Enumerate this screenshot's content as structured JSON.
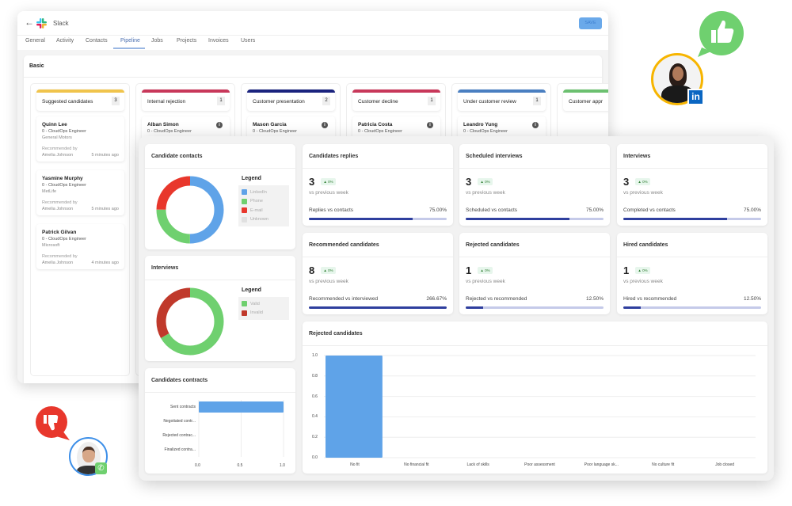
{
  "app": {
    "title": "Slack",
    "save_label": "SAVE"
  },
  "tabs": [
    "General",
    "Activity",
    "Contacts",
    "Pipeline",
    "Jobs",
    "Projects",
    "Invoices",
    "Users"
  ],
  "active_tab": "Pipeline",
  "section_title": "Basic",
  "pipeline": [
    {
      "label": "Suggested candidates",
      "count": "3",
      "color": "#f0c44c",
      "cards": [
        {
          "name": "Quinn Lee",
          "role": "0 - CloudOps Engineer",
          "company": "General Motors",
          "recommended_label": "Recommended by",
          "recommender": "Amelia Johnson",
          "time": "5 minutes ago"
        },
        {
          "name": "Yasmine Murphy",
          "role": "0 - CloudOps Engineer",
          "company": "MetLife",
          "recommended_label": "Recommended by",
          "recommender": "Amelia Johnson",
          "time": "5 minutes ago"
        },
        {
          "name": "Patrick Gilvan",
          "role": "0 - CloudOps Engineer",
          "company": "Microsoft",
          "recommended_label": "Recommended by",
          "recommender": "Amelia Johnson",
          "time": "4 minutes ago"
        }
      ]
    },
    {
      "label": "Internal rejection",
      "count": "1",
      "color": "#c8385a",
      "cards": [
        {
          "name": "Alban Simon",
          "role": "0 - CloudOps Engineer"
        }
      ]
    },
    {
      "label": "Customer presentation",
      "count": "2",
      "color": "#1a237e",
      "cards": [
        {
          "name": "Mason Garcia",
          "role": "0 - CloudOps Engineer"
        }
      ]
    },
    {
      "label": "Customer decline",
      "count": "1",
      "color": "#c8385a",
      "cards": [
        {
          "name": "Patricia Costa",
          "role": "0 - CloudOps Engineer"
        }
      ]
    },
    {
      "label": "Under customer review",
      "count": "1",
      "color": "#4a7fc1",
      "cards": [
        {
          "name": "Leandro Yung",
          "role": "0 - CloudOps Engineer"
        }
      ]
    },
    {
      "label": "Customer appr",
      "count": "",
      "color": "#6cc070",
      "cards": []
    }
  ],
  "stats": [
    {
      "title": "Candidates replies",
      "value": "3",
      "change": "▲ 0%",
      "vs": "vs previous week",
      "progress_label": "Replies vs contacts",
      "progress_value": "75.00%",
      "progress": 75
    },
    {
      "title": "Scheduled interviews",
      "value": "3",
      "change": "▲ 0%",
      "vs": "vs previous week",
      "progress_label": "Scheduled vs contacts",
      "progress_value": "75.00%",
      "progress": 75
    },
    {
      "title": "Interviews",
      "value": "3",
      "change": "▲ 0%",
      "vs": "vs previous week",
      "progress_label": "Completed vs contacts",
      "progress_value": "75.00%",
      "progress": 75
    },
    {
      "title": "Recommended candidates",
      "value": "8",
      "change": "▲ 0%",
      "vs": "vs previous week",
      "progress_label": "Recommended vs interviewed",
      "progress_value": "266.67%",
      "progress": 100
    },
    {
      "title": "Rejected candidates",
      "value": "1",
      "change": "▲ 0%",
      "vs": "vs previous week",
      "progress_label": "Rejected vs recommended",
      "progress_value": "12.50%",
      "progress": 12.5
    },
    {
      "title": "Hired candidates",
      "value": "1",
      "change": "▲ 0%",
      "vs": "vs previous week",
      "progress_label": "Hired vs recommended",
      "progress_value": "12.50%",
      "progress": 12.5
    }
  ],
  "chart_data": [
    {
      "type": "pie",
      "title": "Candidate contacts",
      "legend_title": "Legend",
      "legend": "right",
      "categories": [
        "LinkedIn",
        "Phone",
        "E-mail",
        "Unknown"
      ],
      "values": [
        2,
        1,
        1,
        0
      ],
      "colors": [
        "#5fa3e8",
        "#6fd06f",
        "#e8372c",
        "#e0e0e0"
      ]
    },
    {
      "type": "pie",
      "title": "Interviews",
      "legend_title": "Legend",
      "legend": "right",
      "categories": [
        "Valid",
        "Invalid"
      ],
      "values": [
        2,
        1
      ],
      "colors": [
        "#6fd06f",
        "#c0392b"
      ]
    },
    {
      "type": "bar",
      "orientation": "horizontal",
      "title": "Candidates contracts",
      "categories": [
        "Sent contracts",
        "Negotiated contr...",
        "Rejected contrac...",
        "Finalized contra..."
      ],
      "values": [
        1,
        0,
        0,
        0
      ],
      "xlim": [
        0,
        1
      ],
      "ticks": [
        "0.0",
        "0.5",
        "1.0"
      ],
      "color": "#5fa3e8",
      "grid": true
    },
    {
      "type": "bar",
      "title": "Rejected candidates",
      "categories": [
        "No fit",
        "No financial fit",
        "Lack of skills",
        "Poor assessment",
        "Poor language sk...",
        "No culture fit",
        "Job closed"
      ],
      "values": [
        1,
        0,
        0,
        0,
        0,
        0,
        0
      ],
      "ylim": [
        0,
        1
      ],
      "ticks": [
        "0.0",
        "0.2",
        "0.4",
        "0.6",
        "0.8",
        "1.0"
      ],
      "color": "#5fa3e8",
      "grid": true
    }
  ],
  "decor": {
    "like_color": "#6fd06f",
    "dislike_color": "#e8372c",
    "linkedin_badge": "in",
    "ring_top": "#f7b500",
    "ring_bottom": "#3d8fe8"
  }
}
